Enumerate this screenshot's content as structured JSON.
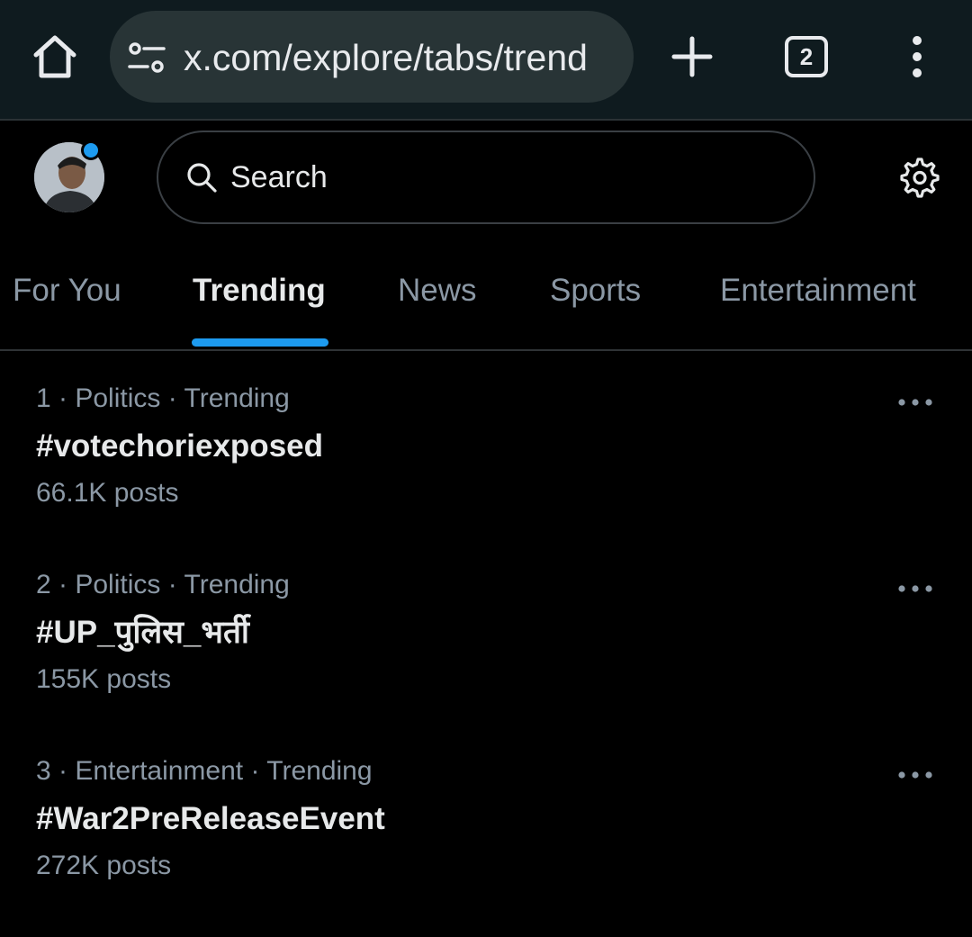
{
  "browser": {
    "url": "x.com/explore/tabs/trend",
    "tab_count": "2",
    "icons": [
      "home-icon",
      "site-settings-icon",
      "plus-icon",
      "tab-switcher-icon",
      "kebab-menu-icon"
    ]
  },
  "header": {
    "search_placeholder": "Search",
    "notification_dot_color": "#1d9bf0"
  },
  "tabs": [
    {
      "label": "For You"
    },
    {
      "label": "Trending"
    },
    {
      "label": "News"
    },
    {
      "label": "Sports"
    },
    {
      "label": "Entertainment"
    }
  ],
  "active_tab": "Trending",
  "trends": [
    {
      "rank": "1",
      "category": "Politics",
      "status": "Trending",
      "title": "#votechoriexposed",
      "posts": "66.1K posts"
    },
    {
      "rank": "2",
      "category": "Politics",
      "status": "Trending",
      "title": "#UP_पुलिस_भर्ती",
      "posts": "155K posts"
    },
    {
      "rank": "3",
      "category": "Entertainment",
      "status": "Trending",
      "title": "#War2PreReleaseEvent",
      "posts": "272K posts"
    }
  ],
  "colors": {
    "accent": "#1d9bf0",
    "background": "#000000",
    "browser_bar": "#0f1b1f",
    "secondary_text": "#8b98a5"
  }
}
